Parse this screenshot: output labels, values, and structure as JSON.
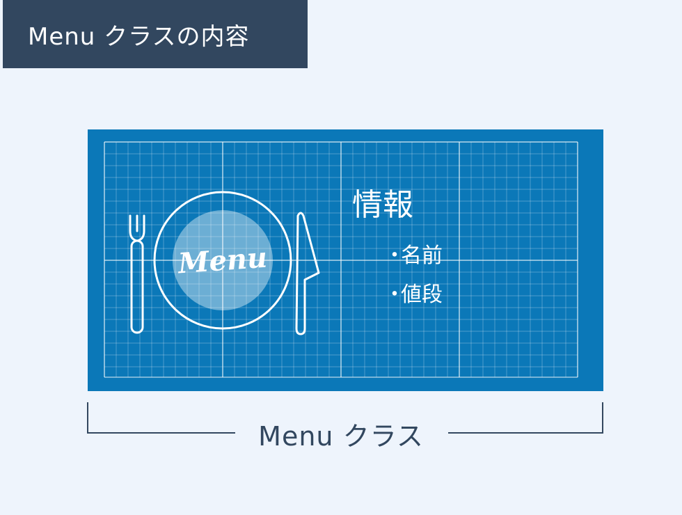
{
  "title": "Menu クラスの内容",
  "board": {
    "info_heading": "情報",
    "items": [
      "名前",
      "値段"
    ],
    "bullet": "・",
    "plate_label": "Menu",
    "icons": [
      "fork-icon",
      "plate-icon",
      "knife-icon"
    ]
  },
  "caption": "Menu クラス",
  "colors": {
    "banner": "#32475f",
    "background": "#eef4fc",
    "board": "#0b78b8",
    "text_dark": "#32475f"
  }
}
